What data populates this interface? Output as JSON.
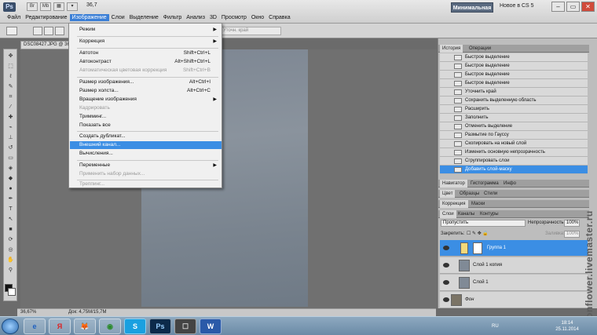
{
  "app": {
    "logo": "Ps",
    "zoom": "36,7",
    "workspace": "Минимальная",
    "new_in": "Новое в CS 5",
    "win_min": "–",
    "win_max": "▭",
    "win_close": "✕"
  },
  "menus": [
    "Файл",
    "Редактирование",
    "Изображение",
    "Слои",
    "Выделение",
    "Фильтр",
    "Анализ",
    "3D",
    "Просмотр",
    "Окно",
    "Справка"
  ],
  "options": {
    "refine": "Уточн. край"
  },
  "document": {
    "tab": "DSC08427.JPG @ 36,7...",
    "zoom_status": "36,67%",
    "doc_size": "Док: 4,75M/15,7M"
  },
  "image_menu": {
    "items": [
      {
        "label": "Режим",
        "shortcut": "",
        "arrow": true,
        "disabled": false
      },
      {
        "label": "Коррекция",
        "shortcut": "",
        "arrow": true,
        "disabled": false
      },
      {
        "label": "Автотон",
        "shortcut": "Shift+Ctrl+L",
        "arrow": false,
        "disabled": false
      },
      {
        "label": "Автоконтраст",
        "shortcut": "Alt+Shift+Ctrl+L",
        "arrow": false,
        "disabled": false
      },
      {
        "label": "Автоматическая цветовая коррекция",
        "shortcut": "Shift+Ctrl+B",
        "arrow": false,
        "disabled": true
      },
      {
        "label": "Размер изображения...",
        "shortcut": "Alt+Ctrl+I",
        "arrow": false,
        "disabled": false
      },
      {
        "label": "Размер холста...",
        "shortcut": "Alt+Ctrl+C",
        "arrow": false,
        "disabled": false
      },
      {
        "label": "Вращение изображения",
        "shortcut": "",
        "arrow": true,
        "disabled": false
      },
      {
        "label": "Кадрировать",
        "shortcut": "",
        "arrow": false,
        "disabled": true
      },
      {
        "label": "Тримминг...",
        "shortcut": "",
        "arrow": false,
        "disabled": false
      },
      {
        "label": "Показать все",
        "shortcut": "",
        "arrow": false,
        "disabled": false
      },
      {
        "label": "Создать дубликат...",
        "shortcut": "",
        "arrow": false,
        "disabled": false
      },
      {
        "label": "Внешний канал...",
        "shortcut": "",
        "arrow": false,
        "disabled": false,
        "highlighted": true
      },
      {
        "label": "Вычисления...",
        "shortcut": "",
        "arrow": false,
        "disabled": false
      },
      {
        "label": "Переменные",
        "shortcut": "",
        "arrow": true,
        "disabled": false
      },
      {
        "label": "Применить набор данных...",
        "shortcut": "",
        "arrow": false,
        "disabled": true
      },
      {
        "label": "Треппинг...",
        "shortcut": "",
        "arrow": false,
        "disabled": true
      }
    ]
  },
  "history": {
    "tabs": [
      "История",
      "Операции"
    ],
    "items": [
      "Быстрое выделение",
      "Быстрое выделение",
      "Быстрое выделение",
      "Быстрое выделение",
      "Уточнить край",
      "Сохранить выделенную область",
      "Расширить",
      "Заполнить",
      "Отменить выделение",
      "Размытие по Гауссу",
      "Скопировать на новый слой",
      "Изменить основную непрозрачность",
      "Сгруппировать слои",
      "Добавить слой-маску"
    ]
  },
  "nav_tabs": [
    "Навигатор",
    "Гистограмма",
    "Инфо"
  ],
  "color_tabs": [
    "Цвет",
    "Образцы",
    "Стили"
  ],
  "adj_tabs": [
    "Коррекция",
    "Маски"
  ],
  "layers": {
    "tabs": [
      "Слои",
      "Каналы",
      "Контуры"
    ],
    "blend": "Пропустить",
    "opacity_label": "Непрозрачность:",
    "opacity": "100%",
    "lock_label": "Закрепить:",
    "fill_label": "Заливка:",
    "fill": "100%",
    "items": [
      "Группа 1",
      "Слой 1 копия",
      "Слой 1",
      "Фон"
    ]
  },
  "watermark": "moonflower.livemaster.ru",
  "taskbar": {
    "apps": [
      "e",
      "Я",
      "🦊",
      "◉",
      "S",
      "Ps",
      "☐",
      "W"
    ],
    "lang": "RU",
    "time": "18:14",
    "date": "25.11.2014"
  }
}
